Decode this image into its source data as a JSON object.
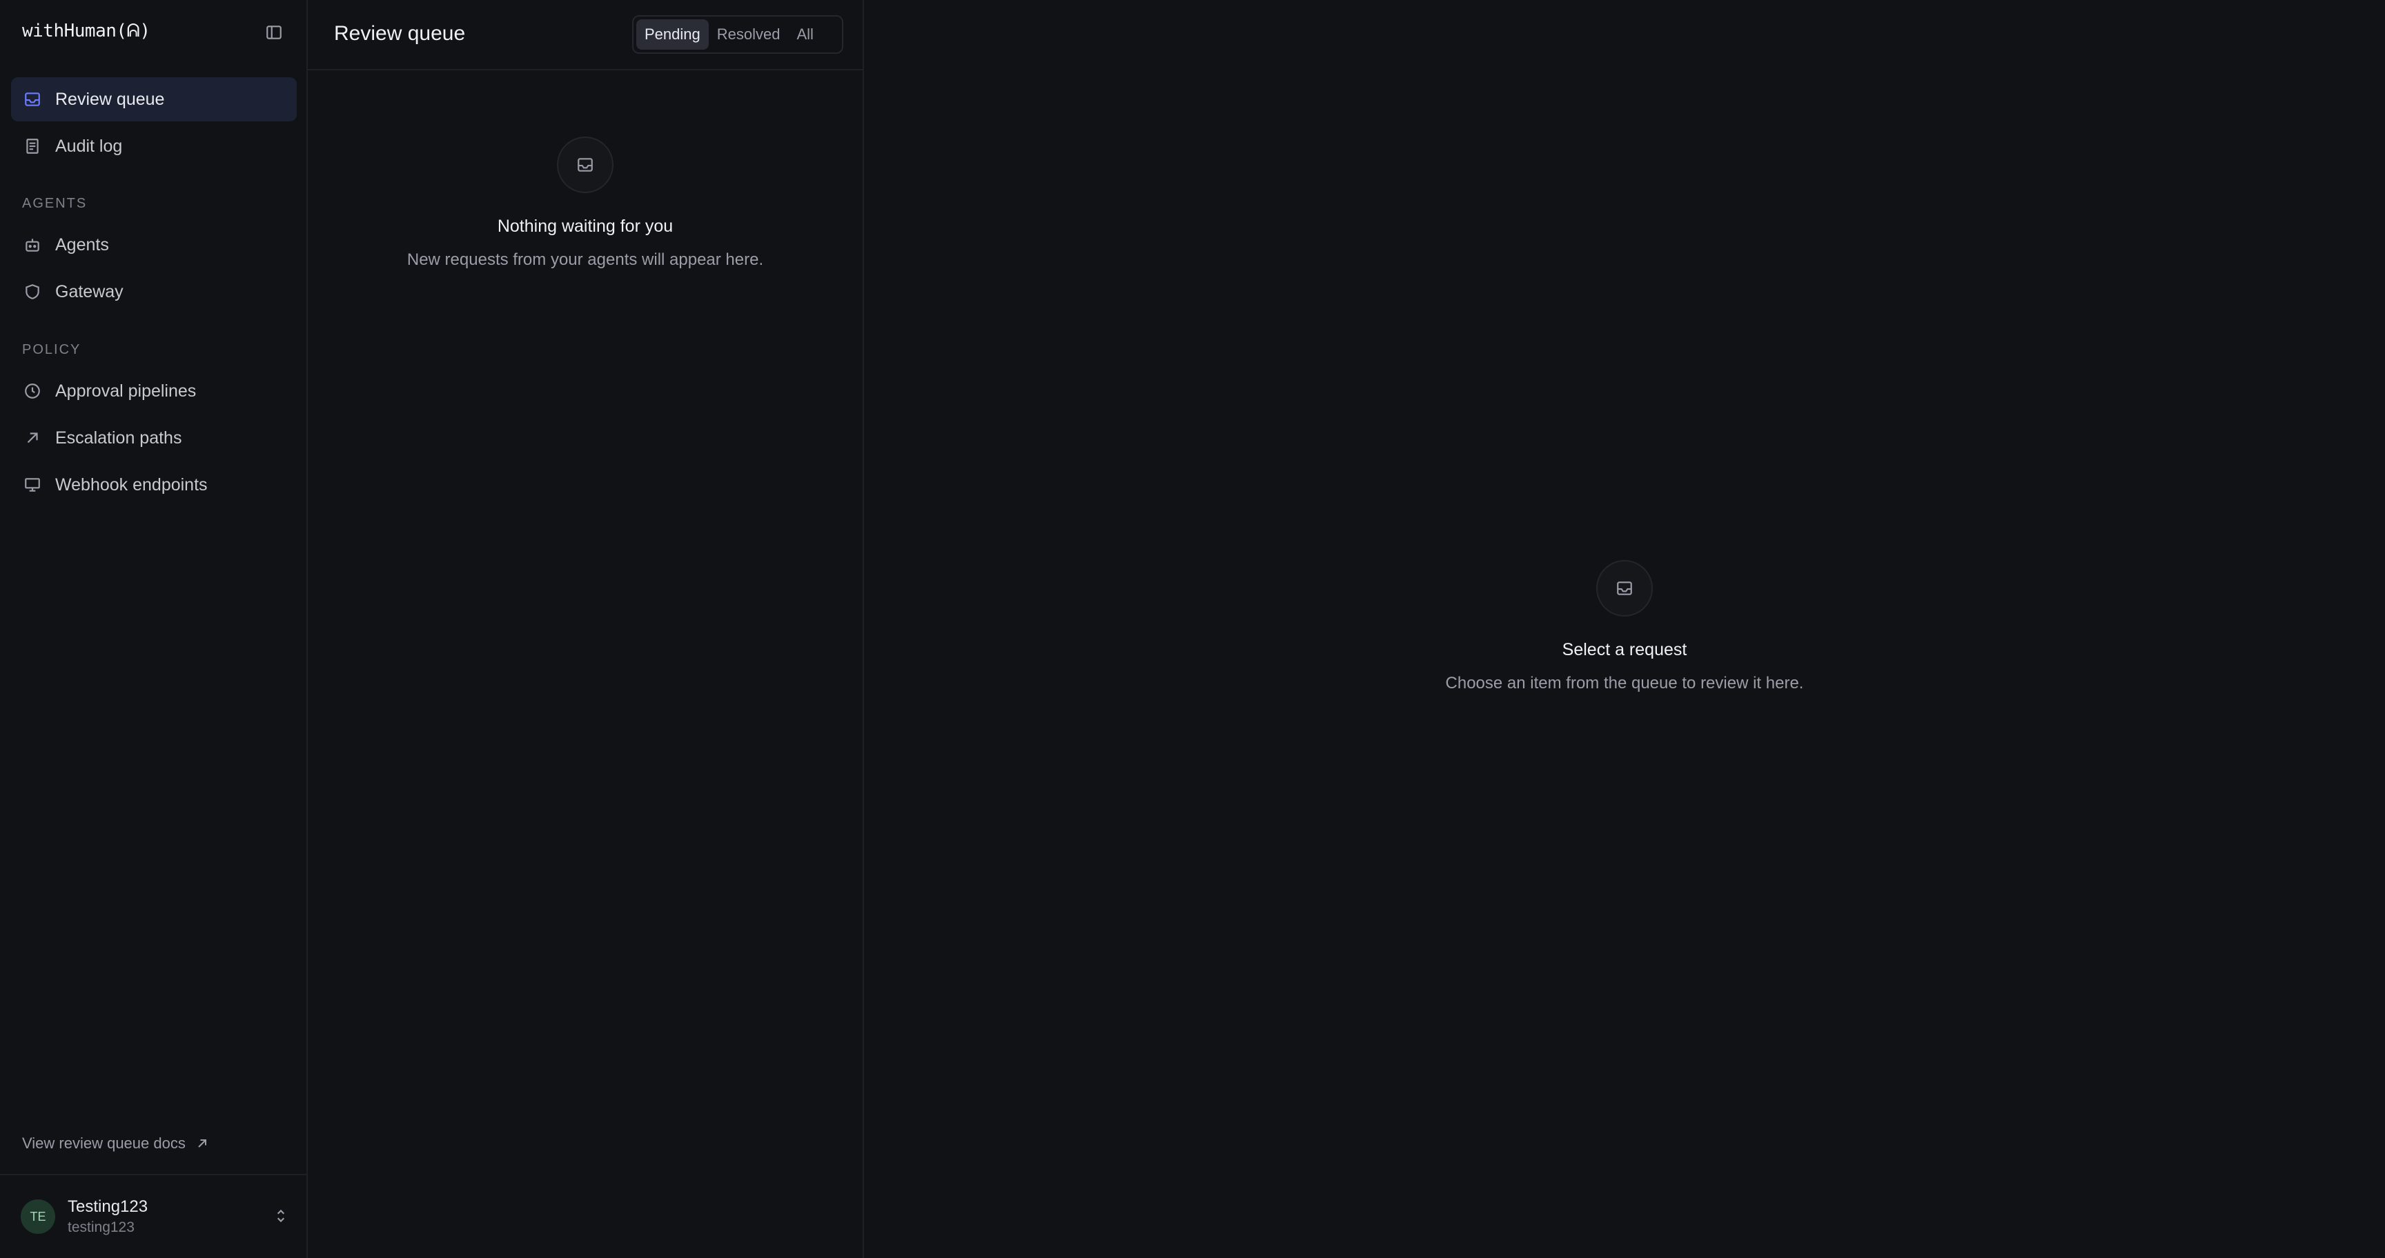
{
  "brand": "withHuman(ᕱ)",
  "sidebar": {
    "main_items": [
      {
        "label": "Review queue",
        "icon": "inbox-icon",
        "active": true
      },
      {
        "label": "Audit log",
        "icon": "document-icon",
        "active": false
      }
    ],
    "sections": [
      {
        "label": "AGENTS",
        "items": [
          {
            "label": "Agents",
            "icon": "bot-icon"
          },
          {
            "label": "Gateway",
            "icon": "shield-icon"
          }
        ]
      },
      {
        "label": "POLICY",
        "items": [
          {
            "label": "Approval pipelines",
            "icon": "clock-icon"
          },
          {
            "label": "Escalation paths",
            "icon": "arrow-up-right-icon"
          },
          {
            "label": "Webhook endpoints",
            "icon": "monitor-icon"
          }
        ]
      }
    ],
    "docs_link": "View review queue docs",
    "user": {
      "initials": "TE",
      "name": "Testing123",
      "handle": "testing123"
    }
  },
  "queue": {
    "title": "Review queue",
    "filters": [
      "Pending",
      "Resolved",
      "All"
    ],
    "active_filter": "Pending",
    "empty_title": "Nothing waiting for you",
    "empty_sub": "New requests from your agents will appear here."
  },
  "detail": {
    "empty_title": "Select a request",
    "empty_sub": "Choose an item from the queue to review it here."
  },
  "colors": {
    "accent": "#6b7cff",
    "active_bg": "#1c2233",
    "background": "#111216"
  }
}
